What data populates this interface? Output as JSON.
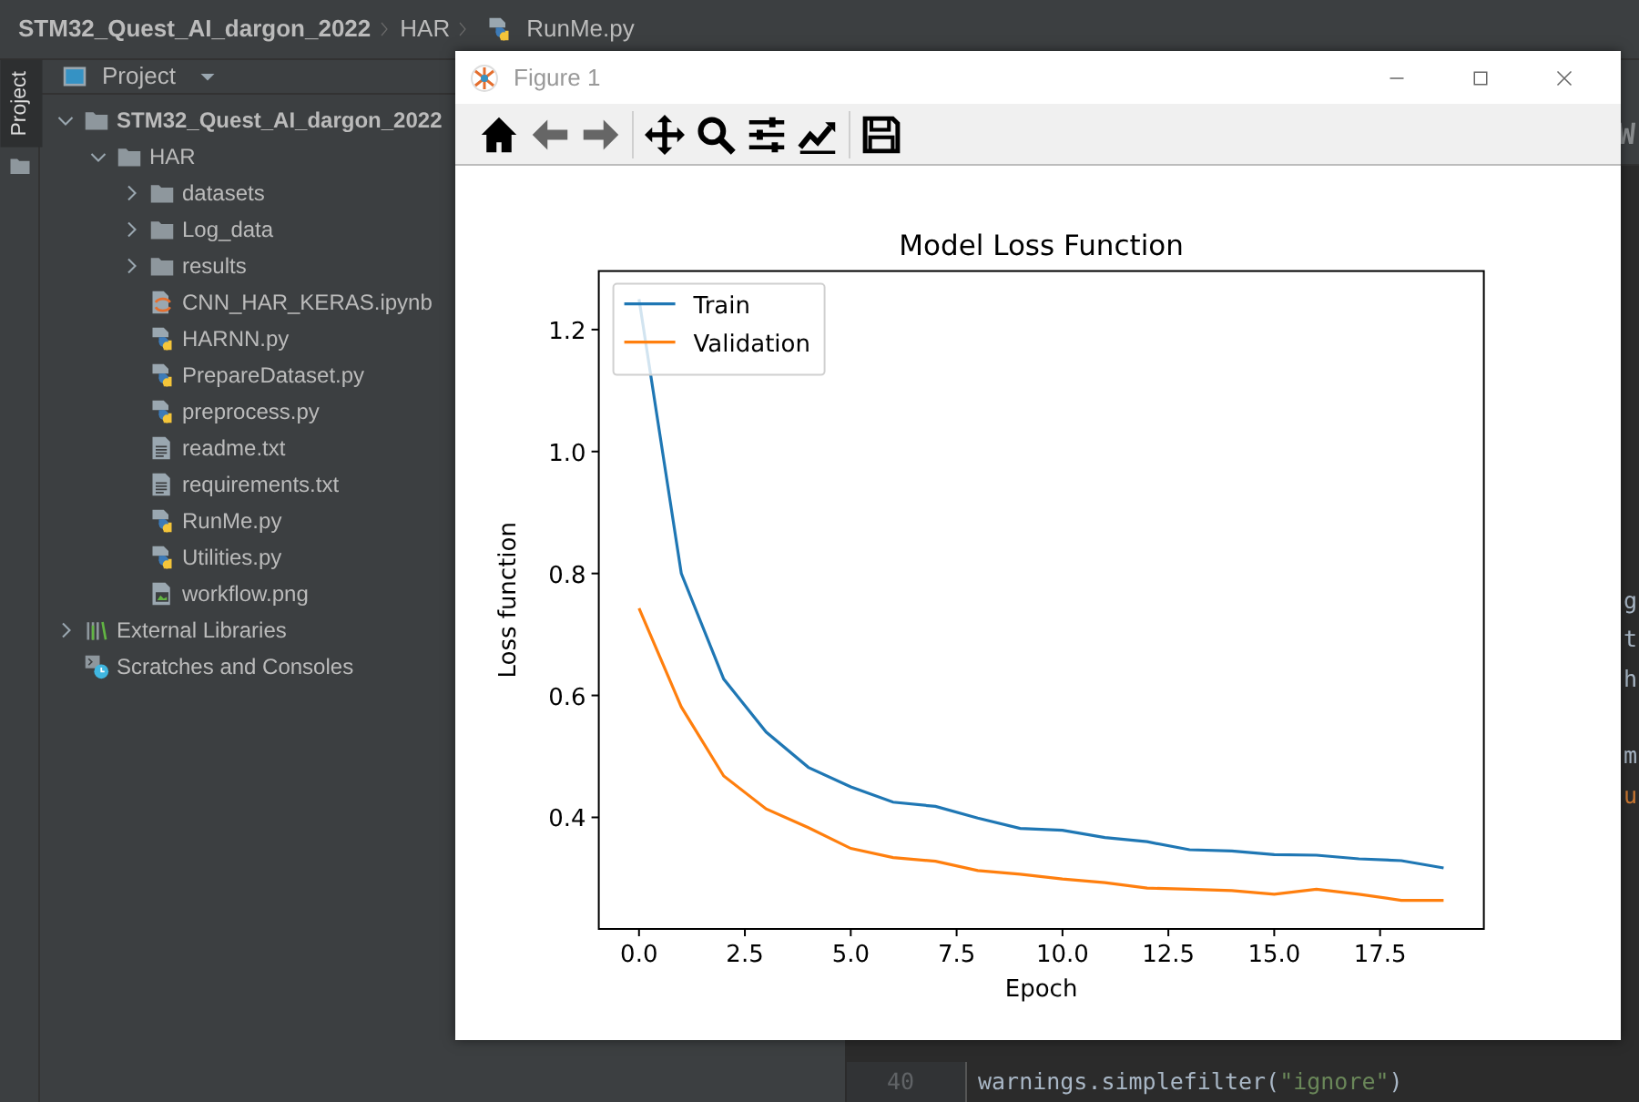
{
  "breadcrumb": [
    {
      "label": "STM32_Quest_AI_dargon_2022",
      "kind": "project"
    },
    {
      "label": "HAR",
      "kind": "folder"
    },
    {
      "label": "RunMe.py",
      "kind": "python"
    }
  ],
  "side_tab": {
    "label": "Project",
    "selected": true
  },
  "project_panel": {
    "title": "Project",
    "tree": [
      {
        "label": "STM32_Quest_AI_dargon_2022",
        "kind": "folder",
        "expanded": true,
        "children": [
          {
            "label": "HAR",
            "kind": "folder",
            "expanded": true,
            "children": [
              {
                "label": "datasets",
                "kind": "folder",
                "expanded": false
              },
              {
                "label": "Log_data",
                "kind": "folder",
                "expanded": false
              },
              {
                "label": "results",
                "kind": "folder",
                "expanded": false
              },
              {
                "label": "CNN_HAR_KERAS.ipynb",
                "kind": "notebook"
              },
              {
                "label": "HARNN.py",
                "kind": "python"
              },
              {
                "label": "PrepareDataset.py",
                "kind": "python"
              },
              {
                "label": "preprocess.py",
                "kind": "python"
              },
              {
                "label": "readme.txt",
                "kind": "text"
              },
              {
                "label": "requirements.txt",
                "kind": "text"
              },
              {
                "label": "RunMe.py",
                "kind": "python"
              },
              {
                "label": "Utilities.py",
                "kind": "python"
              },
              {
                "label": "workflow.png",
                "kind": "image"
              }
            ]
          }
        ]
      },
      {
        "label": "External Libraries",
        "kind": "libraries",
        "expanded": false
      },
      {
        "label": "Scratches and Consoles",
        "kind": "scratches"
      }
    ]
  },
  "editor": {
    "tab_fragment": "W",
    "fragment_blocks": [
      [
        {
          "text": "g",
          "kind": "plain"
        },
        {
          "text": "t",
          "kind": "plain"
        },
        {
          "text": "h",
          "kind": "plain"
        }
      ],
      [
        {
          "text": "m",
          "kind": "plain"
        },
        {
          "text": "u",
          "kind": "keyword"
        }
      ]
    ],
    "lines": [
      {
        "number": "40",
        "tokens": [
          {
            "text": "warnings.simplefilter(",
            "kind": "plain"
          },
          {
            "text": "\"ignore\"",
            "kind": "string"
          },
          {
            "text": ")",
            "kind": "plain"
          }
        ]
      }
    ]
  },
  "figure_window": {
    "title": "Figure 1",
    "chart_data": {
      "type": "line",
      "legend": true,
      "title": "Model Loss Function",
      "xlabel": "Epoch",
      "ylabel": "Loss function",
      "x": [
        0,
        1,
        2,
        3,
        4,
        5,
        6,
        7,
        8,
        9,
        10,
        11,
        12,
        13,
        14,
        15,
        16,
        17,
        18,
        19
      ],
      "series": [
        {
          "name": "Train",
          "color": "#1f77b4",
          "values": [
            1.25,
            0.8,
            0.627,
            0.54,
            0.482,
            0.45,
            0.425,
            0.418,
            0.399,
            0.382,
            0.379,
            0.367,
            0.36,
            0.347,
            0.345,
            0.339,
            0.338,
            0.332,
            0.329,
            0.317
          ]
        },
        {
          "name": "Validation",
          "color": "#ff7f0e",
          "values": [
            0.743,
            0.581,
            0.468,
            0.414,
            0.383,
            0.349,
            0.334,
            0.328,
            0.313,
            0.307,
            0.299,
            0.293,
            0.284,
            0.282,
            0.28,
            0.274,
            0.282,
            0.274,
            0.264,
            0.264
          ]
        }
      ],
      "xlim": [
        -0.95,
        19.95
      ],
      "ylim": [
        0.217,
        1.296
      ],
      "xticks": [
        {
          "value": 0,
          "label": "0.0"
        },
        {
          "value": 2.5,
          "label": "2.5"
        },
        {
          "value": 5,
          "label": "5.0"
        },
        {
          "value": 7.5,
          "label": "7.5"
        },
        {
          "value": 10,
          "label": "10.0"
        },
        {
          "value": 12.5,
          "label": "12.5"
        },
        {
          "value": 15,
          "label": "15.0"
        },
        {
          "value": 17.5,
          "label": "17.5"
        }
      ],
      "yticks": [
        {
          "value": 0.4,
          "label": "0.4"
        },
        {
          "value": 0.6,
          "label": "0.6"
        },
        {
          "value": 0.8,
          "label": "0.8"
        },
        {
          "value": 1.0,
          "label": "1.0"
        },
        {
          "value": 1.2,
          "label": "1.2"
        }
      ]
    }
  }
}
